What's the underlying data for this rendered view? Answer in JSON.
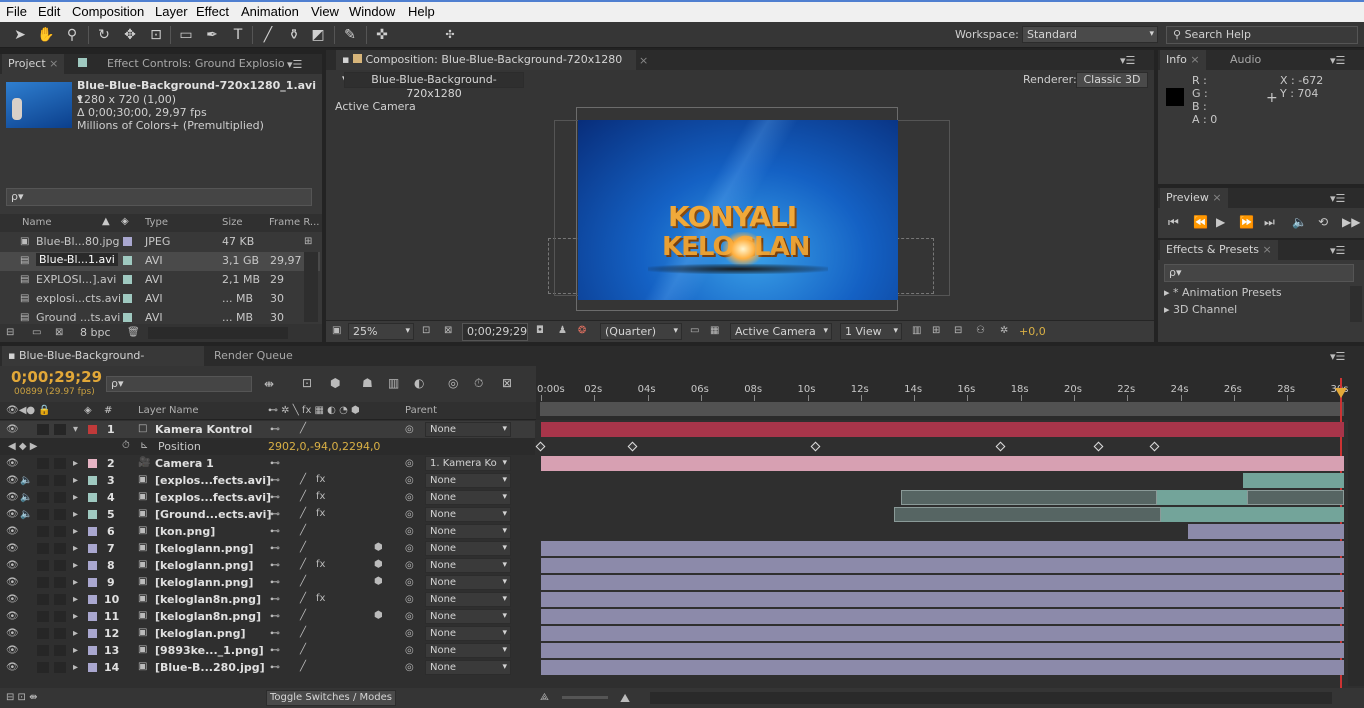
{
  "menubar": {
    "items": [
      "File",
      "Edit",
      "Composition",
      "Layer",
      "Effect",
      "Animation",
      "View",
      "Window",
      "Help"
    ]
  },
  "toolbar": {
    "workspace_label": "Workspace:",
    "workspace_value": "Standard",
    "search_help": "Search Help"
  },
  "project": {
    "tab_project": "Project",
    "tab_effect_controls": "Effect Controls: Ground Explosio",
    "footage_name": "Blue-Blue-Background-720x1280_1.avi ▾",
    "footage_size": "1280 x 720 (1,00)",
    "footage_duration": "Δ 0;00;30;00, 29,97 fps",
    "footage_colors": "Millions of Colors+ (Premultiplied)",
    "search_placeholder": "ρ▾",
    "columns": {
      "name": "Name",
      "type": "Type",
      "size": "Size",
      "frame_rate": "Frame R..."
    },
    "files": [
      {
        "name": "Blue-Bl...80.jpg",
        "type": "JPEG",
        "size": "47 KB",
        "fps": ""
      },
      {
        "name": "Blue-Bl...1.avi",
        "type": "AVI",
        "size": "3,1 GB",
        "fps": "29,97"
      },
      {
        "name": "EXPLOSI...].avi",
        "type": "AVI",
        "size": "2,1 MB",
        "fps": "29"
      },
      {
        "name": "explosi...cts.avi",
        "type": "AVI",
        "size": "... MB",
        "fps": "30"
      },
      {
        "name": "Ground ...ts.avi",
        "type": "AVI",
        "size": "... MB",
        "fps": "30"
      }
    ],
    "bpc": "8 bpc"
  },
  "composition": {
    "tab": "Composition: Blue-Blue-Background-720x1280",
    "comp_button": "Blue-Blue-Background-720x1280",
    "renderer_label": "Renderer:",
    "renderer_value": "Classic 3D",
    "active_camera_label": "Active Camera",
    "title_line1": "KONYALI",
    "title_line2": "KELOGLAN",
    "zoom": "25%",
    "timecode": "0;00;29;29",
    "resolution": "(Quarter)",
    "view": "Active Camera",
    "view_count": "1 View",
    "exposure": "+0,0"
  },
  "info": {
    "tab_info": "Info",
    "tab_audio": "Audio",
    "r": "R :",
    "g": "G :",
    "b": "B :",
    "a": "A : 0",
    "x": "X : -672",
    "y": "Y : 704"
  },
  "preview": {
    "tab": "Preview"
  },
  "effects": {
    "tab": "Effects & Presets",
    "search": "ρ▾",
    "items": [
      "▸ * Animation Presets",
      "▸ 3D Channel"
    ]
  },
  "timeline": {
    "tab_comp": "Blue-Blue-Background-720x1280",
    "tab_render": "Render Queue",
    "timecode": "0;00;29;29",
    "frames": "00899 (29.97 fps)",
    "search": "ρ▾",
    "col_num": "#",
    "col_layer_name": "Layer Name",
    "col_parent": "Parent",
    "ruler": [
      "0:00s",
      "02s",
      "04s",
      "06s",
      "08s",
      "10s",
      "12s",
      "14s",
      "16s",
      "18s",
      "20s",
      "22s",
      "24s",
      "26s",
      "28s",
      "30s"
    ],
    "position_label": "Position",
    "position_value": "2902,0,-94,0,2294,0",
    "toggle_label": "Toggle Switches / Modes",
    "layers": [
      {
        "n": "1",
        "name": "Kamera Kontrol",
        "parent": "None",
        "color": "#c03a3a"
      },
      {
        "n": "2",
        "name": "Camera 1",
        "parent": "1. Kamera Ko",
        "color": "#e6b4c4"
      },
      {
        "n": "3",
        "name": "[explos...fects.avi]",
        "parent": "None",
        "color": "#9fc9c0"
      },
      {
        "n": "4",
        "name": "[explos...fects.avi]",
        "parent": "None",
        "color": "#9fc9c0"
      },
      {
        "n": "5",
        "name": "[Ground...ects.avi]",
        "parent": "None",
        "color": "#9fc9c0"
      },
      {
        "n": "6",
        "name": "[kon.png]",
        "parent": "None",
        "color": "#a9a7cf"
      },
      {
        "n": "7",
        "name": "[keloglann.png]",
        "parent": "None",
        "color": "#a9a7cf"
      },
      {
        "n": "8",
        "name": "[keloglann.png]",
        "parent": "None",
        "color": "#a9a7cf"
      },
      {
        "n": "9",
        "name": "[keloglann.png]",
        "parent": "None",
        "color": "#a9a7cf"
      },
      {
        "n": "10",
        "name": "[keloglan8n.png]",
        "parent": "None",
        "color": "#a9a7cf"
      },
      {
        "n": "11",
        "name": "[keloglan8n.png]",
        "parent": "None",
        "color": "#a9a7cf"
      },
      {
        "n": "12",
        "name": "[keloglan.png]",
        "parent": "None",
        "color": "#a9a7cf"
      },
      {
        "n": "13",
        "name": "[9893ke..._1.png]",
        "parent": "None",
        "color": "#a9a7cf"
      },
      {
        "n": "14",
        "name": "[Blue-B...280.jpg]",
        "parent": "None",
        "color": "#a9a7cf"
      }
    ]
  }
}
